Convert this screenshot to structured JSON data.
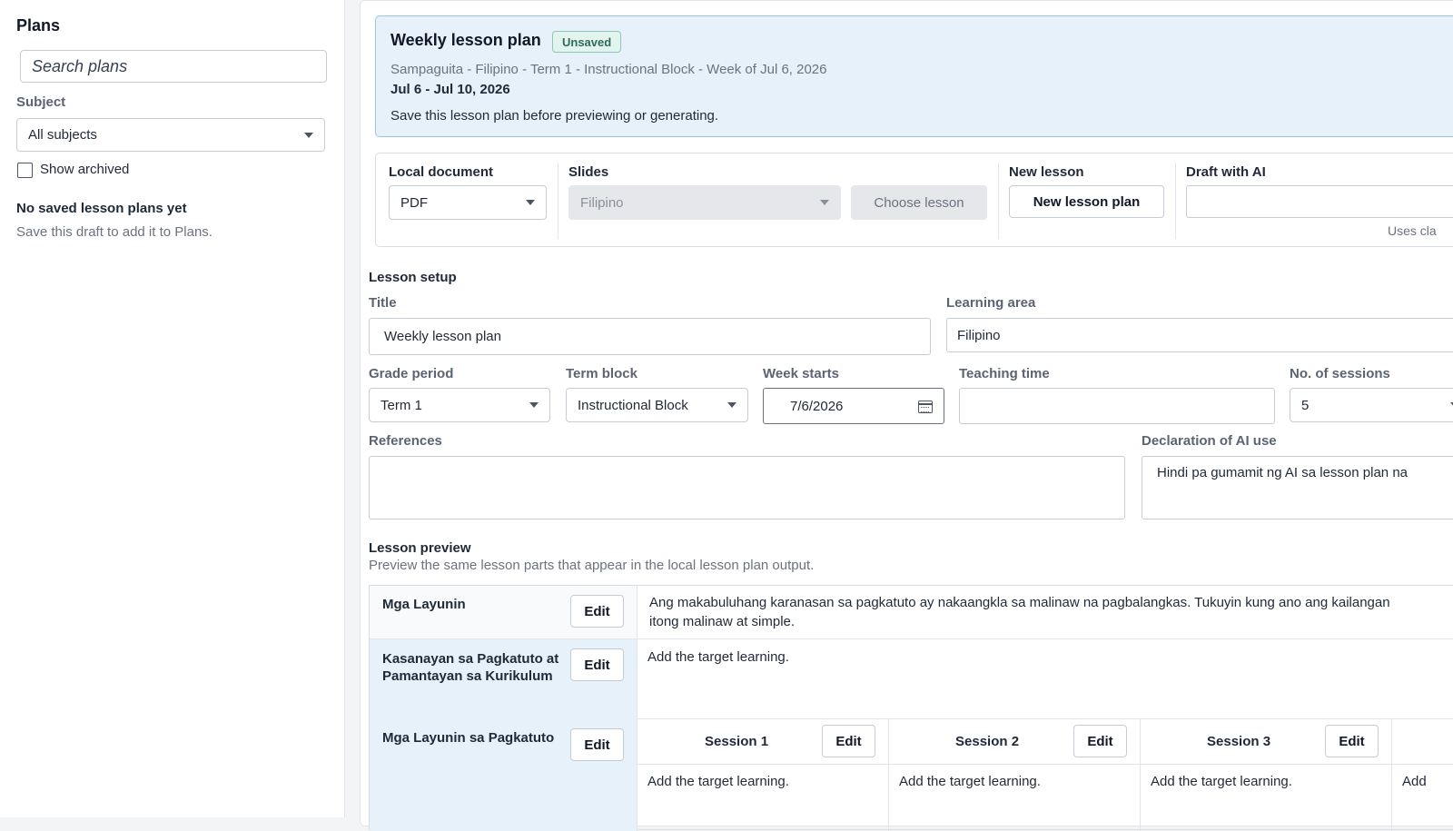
{
  "sidebar": {
    "title": "Plans",
    "search_placeholder": "Search plans",
    "subject_label": "Subject",
    "subject_value": "All subjects",
    "show_archived_label": "Show archived",
    "empty_title": "No saved lesson plans yet",
    "empty_subtitle": "Save this draft to add it to Plans."
  },
  "banner": {
    "title": "Weekly lesson plan",
    "badge": "Unsaved",
    "breadcrumb": "Sampaguita - Filipino - Term 1 - Instructional Block - Week of Jul 6, 2026",
    "date_range": "Jul 6 - Jul 10, 2026",
    "notice": "Save this lesson plan before previewing or generating."
  },
  "tools": {
    "local_document_label": "Local document",
    "local_document_value": "PDF",
    "slides_label": "Slides",
    "slides_value": "Filipino",
    "choose_lesson": "Choose lesson",
    "new_lesson_label": "New lesson",
    "new_lesson_button": "New lesson plan",
    "draft_ai_label": "Draft with AI",
    "draft_ai_note": "Uses cla"
  },
  "setup": {
    "heading": "Lesson setup",
    "title_label": "Title",
    "title_value": "Weekly lesson plan",
    "learning_area_label": "Learning area",
    "learning_area_value": "Filipino",
    "grade_period_label": "Grade period",
    "grade_period_value": "Term 1",
    "term_block_label": "Term block",
    "term_block_value": "Instructional Block",
    "week_starts_label": "Week starts",
    "week_starts_value": "7/6/2026",
    "teaching_time_label": "Teaching time",
    "teaching_time_value": "",
    "sessions_label": "No. of sessions",
    "sessions_value": "5",
    "references_label": "References",
    "references_value": "",
    "ai_declaration_label": "Declaration of AI use",
    "ai_declaration_value": "Hindi pa gumamit ng AI sa lesson plan na"
  },
  "preview": {
    "heading": "Lesson preview",
    "subtitle": "Preview the same lesson parts that appear in the local lesson plan output.",
    "edit_label": "Edit",
    "rows": [
      {
        "label": "Mga Layunin",
        "content_line1": "Ang makabuluhang karanasan sa pagkatuto ay nakaangkla sa malinaw na pagbalangkas. Tukuyin kung ano ang kailangan",
        "content_line2": "itong malinaw at simple."
      },
      {
        "label_line1": "Kasanayan sa Pagkatuto at",
        "label_line2": "Pamantayan sa Kurikulum",
        "content": "Add the target learning."
      },
      {
        "label": "Mga Layunin sa Pagkatuto"
      }
    ],
    "sessions": [
      {
        "name": "Session 1",
        "content": "Add the target learning."
      },
      {
        "name": "Session 2",
        "content": "Add the target learning."
      },
      {
        "name": "Session 3",
        "content": "Add the target learning."
      },
      {
        "content": "Add"
      }
    ]
  }
}
